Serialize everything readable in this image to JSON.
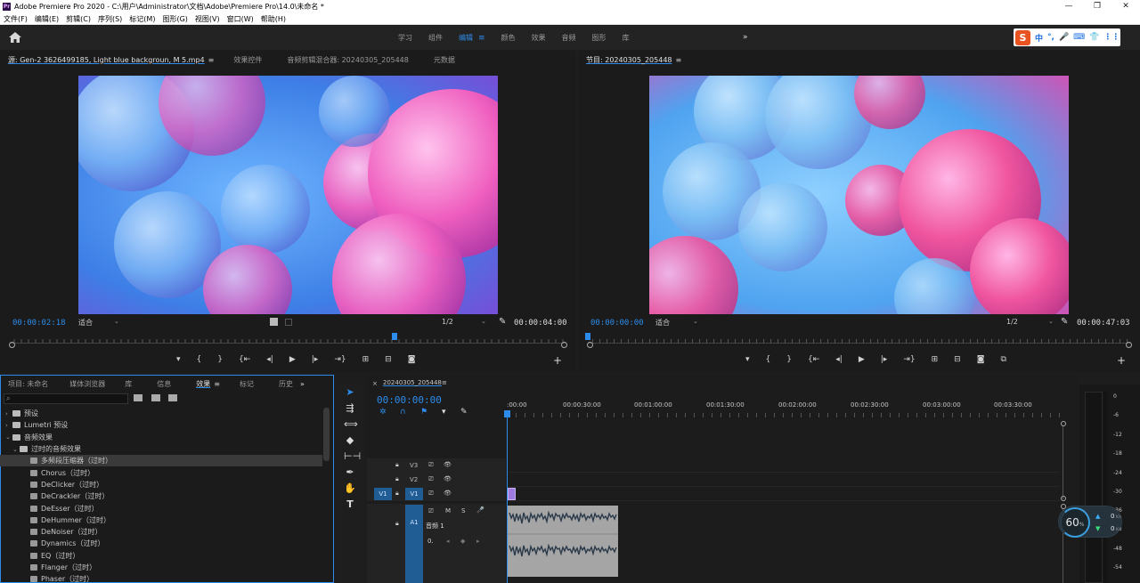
{
  "window": {
    "title": "Adobe Premiere Pro 2020 - C:\\用户\\Administrator\\文档\\Adobe\\Premiere Pro\\14.0\\未命名 *",
    "controls": [
      "—",
      "❐",
      "✕"
    ]
  },
  "menu": [
    "文件(F)",
    "编辑(E)",
    "剪辑(C)",
    "序列(S)",
    "标记(M)",
    "图形(G)",
    "视图(V)",
    "窗口(W)",
    "帮助(H)"
  ],
  "workspaces": {
    "items": [
      "学习",
      "组件",
      "编辑",
      "颜色",
      "效果",
      "音频",
      "图形",
      "库"
    ],
    "active": "编辑",
    "menu_icon": "≡",
    "more": "»"
  },
  "ime": {
    "logo": "S",
    "lang": "中",
    "items": [
      "°,",
      "🎤",
      "⌨",
      "👕",
      "⋮⋮"
    ]
  },
  "source_panel": {
    "tabs": [
      "源: Gen-2 3626499185, Light blue backgroun, M 5.mp4",
      "效果控件",
      "音频剪辑混合器: 20240305_205448",
      "元数据"
    ],
    "tab_menu": "≡",
    "timecode": "00:00:02:18",
    "fit": "适合",
    "scale": "1/2",
    "duration": "00:00:04:00",
    "plus": "+"
  },
  "program_panel": {
    "tabs": [
      "节目: 20240305_205448"
    ],
    "tab_menu": "≡",
    "timecode": "00:00:00:00",
    "fit": "适合",
    "scale": "1/2",
    "duration": "00:00:47:03",
    "plus": "+"
  },
  "project_panel": {
    "tabs": [
      "项目: 未命名",
      "媒体浏览器",
      "库",
      "信息",
      "效果",
      "标记",
      "历史"
    ],
    "active_tab": "效果",
    "tab_menu": "≡",
    "more": "»",
    "search_placeholder": "",
    "search_icon": "⌕",
    "tree": [
      {
        "label": "预设",
        "level": 0,
        "kind": "folder",
        "expanded": false
      },
      {
        "label": "Lumetri 预设",
        "level": 0,
        "kind": "folder",
        "expanded": false
      },
      {
        "label": "音频效果",
        "level": 0,
        "kind": "folder",
        "expanded": true
      },
      {
        "label": "过时的音频效果",
        "level": 1,
        "kind": "folder",
        "expanded": true
      },
      {
        "label": "多频段压缩器（过时）",
        "level": 2,
        "kind": "effect",
        "selected": true
      },
      {
        "label": "Chorus（过时）",
        "level": 2,
        "kind": "effect"
      },
      {
        "label": "DeClicker（过时）",
        "level": 2,
        "kind": "effect"
      },
      {
        "label": "DeCrackler（过时）",
        "level": 2,
        "kind": "effect"
      },
      {
        "label": "DeEsser（过时）",
        "level": 2,
        "kind": "effect"
      },
      {
        "label": "DeHummer（过时）",
        "level": 2,
        "kind": "effect"
      },
      {
        "label": "DeNoiser（过时）",
        "level": 2,
        "kind": "effect"
      },
      {
        "label": "Dynamics（过时）",
        "level": 2,
        "kind": "effect"
      },
      {
        "label": "EQ（过时）",
        "level": 2,
        "kind": "effect"
      },
      {
        "label": "Flanger（过时）",
        "level": 2,
        "kind": "effect"
      },
      {
        "label": "Phaser（过时）",
        "level": 2,
        "kind": "effect"
      }
    ]
  },
  "timeline": {
    "sequence_name": "20240305_205448",
    "tab_menu": "≡",
    "timecode": "00:00:00:00",
    "ruler": [
      ":00:00",
      "00:00:30:00",
      "00:01:00:00",
      "00:01:30:00",
      "00:02:00:00",
      "00:02:30:00",
      "00:03:00:00",
      "00:03:30:00"
    ],
    "tracks": [
      {
        "id": "V3",
        "lock": "🔒",
        "btns": [
          "⎚",
          "👁"
        ]
      },
      {
        "id": "V2",
        "lock": "🔒",
        "btns": [
          "⎚",
          "👁"
        ]
      },
      {
        "id": "V1",
        "src": "V1",
        "lock": "🔒",
        "btns": [
          "⎚",
          "👁"
        ]
      },
      {
        "id": "A1",
        "lock": "🔒",
        "btns": [
          "⎚",
          "M",
          "S",
          "🎤"
        ]
      }
    ],
    "audio_track_name": "音频 1",
    "audio_volume": "0.",
    "audio_nav": [
      "◂",
      "◆",
      "▸"
    ]
  },
  "meter": {
    "scale": [
      "0",
      "-6",
      "-12",
      "-18",
      "-24",
      "-30",
      "-36",
      "-42",
      "-48",
      "-54"
    ],
    "widget_value": "60",
    "widget_unit": "%",
    "up_rate": "0",
    "down_rate": "0",
    "rate_unit": "K/s"
  },
  "colors": {
    "accent": "#2d8ceb",
    "panel_bg": "#1b1b1b",
    "clip_video": "#9e7ae0",
    "clip_audio": "#9f9f9f"
  }
}
